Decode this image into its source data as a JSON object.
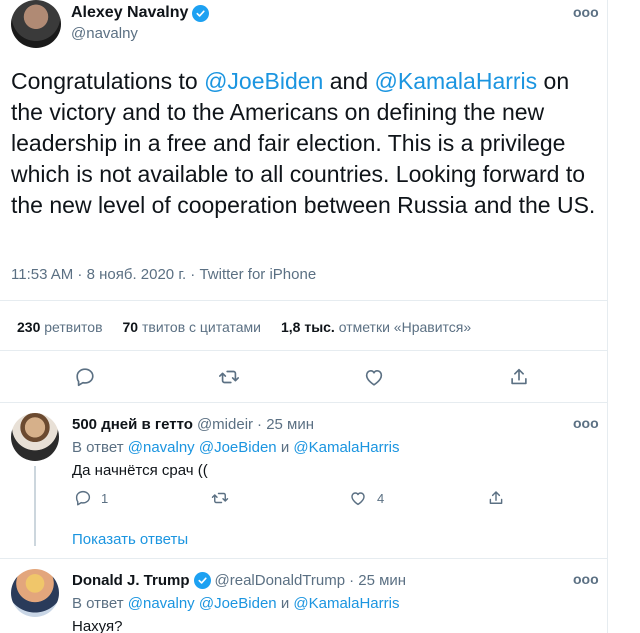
{
  "main_tweet": {
    "author_name": "Alexey Navalny",
    "author_handle": "@navalny",
    "text_parts": [
      "Congratulations to ",
      "@JoeBiden",
      " and ",
      "@KamalaHarris",
      " on the victory and to the Americans on defining the new leadership in a free and fair election. This is a privilege which is not available to all countries. Looking forward to the new level of cooperation between Russia and the US."
    ],
    "meta": "11:53 AM · 8 нояб. 2020 г. · Twitter for iPhone",
    "stats": {
      "retweets_num": "230",
      "retweets_label": "ретвитов",
      "quotes_num": "70",
      "quotes_label": "твитов с цитатами",
      "likes_num": "1,8 тыс.",
      "likes_label": "отметки «Нравится»"
    },
    "more_label": "ooo"
  },
  "replies": [
    {
      "name": "500 дней в гетто",
      "handle": "@mideir",
      "time": "· 25 мин",
      "reply_prefix": "В ответ",
      "reply_mentions": [
        "@navalny",
        "@JoeBiden"
      ],
      "reply_and": "и",
      "reply_last": "@KamalaHarris",
      "text": "Да начнётся срач ((",
      "reply_count": "1",
      "like_count": "4",
      "show_replies": "Показать ответы",
      "more_label": "ooo"
    },
    {
      "name": "Donald J. Trump",
      "handle": "@realDonaldTrump",
      "time": "· 25 мин",
      "reply_prefix": "В ответ",
      "reply_mentions": [
        "@navalny",
        "@JoeBiden"
      ],
      "reply_and": "и",
      "reply_last": "@KamalaHarris",
      "text": "Нахуя?",
      "more_label": "ooo"
    }
  ],
  "colors": {
    "accent": "#1b95e0",
    "verified": "#1da1f2",
    "secondary_text": "#5b7083",
    "divider": "#e6ecf0"
  }
}
